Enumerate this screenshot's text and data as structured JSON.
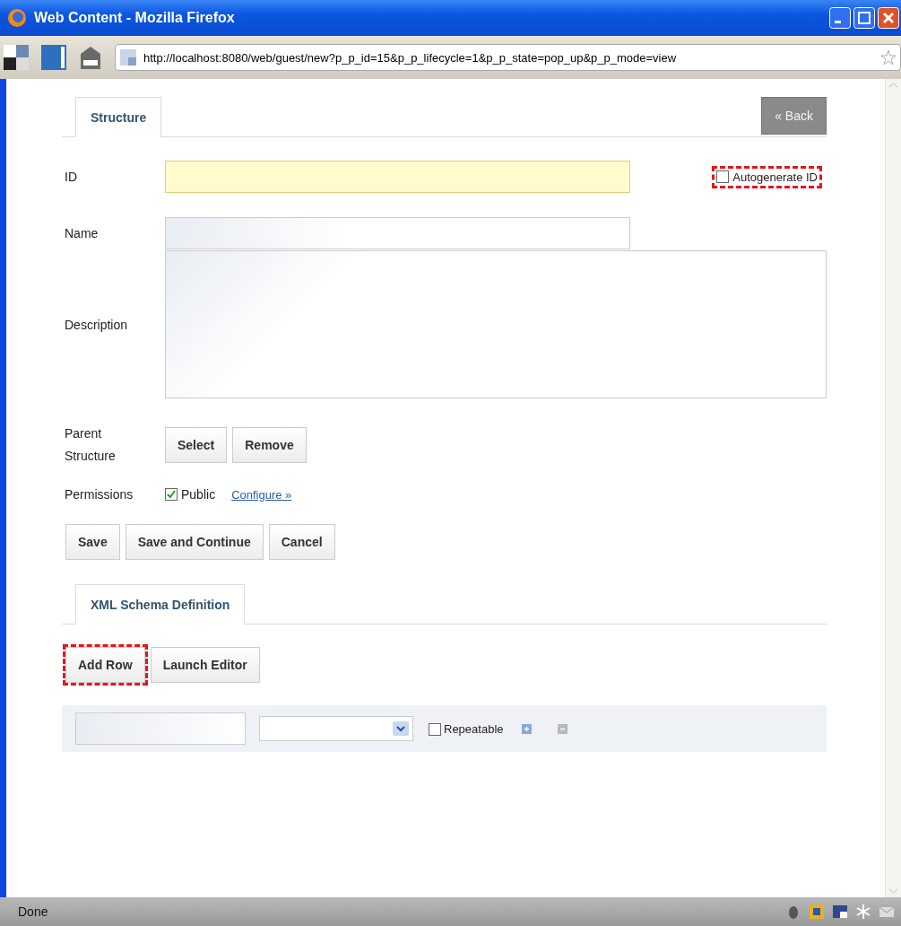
{
  "window": {
    "title": "Web Content - Mozilla Firefox"
  },
  "address_bar": {
    "url": "http://localhost:8080/web/guest/new?p_p_id=15&p_p_lifecycle=1&p_p_state=pop_up&p_p_mode=view"
  },
  "tabs": [
    {
      "label": "Structure",
      "selected": true
    }
  ],
  "back_button": "« Back",
  "fields": [
    {
      "label": "ID",
      "focused": true
    },
    {
      "label": "Name",
      "focused": false
    }
  ],
  "autogenerate": {
    "label": "Autogenerate ID",
    "checked": false,
    "highlighted": true
  },
  "description_field": {
    "label": "Description"
  },
  "parent_structure": {
    "label": "Parent Structure",
    "buttons": [
      "Select",
      "Remove"
    ]
  },
  "permissions": {
    "label": "Permissions",
    "public": {
      "label": "Public",
      "checked": true
    },
    "link": "Configure »"
  },
  "actions": [
    "Save",
    "Save and Continue",
    "Cancel"
  ],
  "schema_tabs": [
    {
      "label": "XML Schema Definition",
      "selected": true
    }
  ],
  "schema_buttons": [
    {
      "label": "Add Row",
      "highlighted": true
    },
    {
      "label": "Launch Editor",
      "highlighted": false
    }
  ],
  "schema_rows": [
    {
      "repeatable": {
        "label": "Repeatable",
        "checked": false
      }
    }
  ],
  "status_bar": {
    "text": "Done"
  }
}
